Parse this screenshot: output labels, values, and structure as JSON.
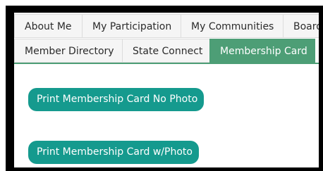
{
  "tabs_row1": [
    {
      "label": "About Me"
    },
    {
      "label": "My Participation"
    },
    {
      "label": "My Communities"
    },
    {
      "label": "Board"
    }
  ],
  "tabs_row2": [
    {
      "label": "Member Directory"
    },
    {
      "label": "State Connect"
    },
    {
      "label": "Membership Card",
      "active": true
    }
  ],
  "buttons": {
    "print_no_photo": "Print Membership Card No Photo",
    "print_with_photo": "Print Membership Card w/Photo"
  },
  "colors": {
    "active_tab": "#4d9e76",
    "button": "#159a8e"
  }
}
